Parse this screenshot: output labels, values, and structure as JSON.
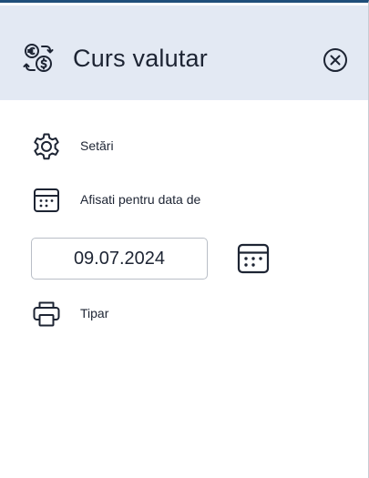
{
  "panel": {
    "title": "Curs valutar",
    "title_icon": "currency-exchange-icon",
    "close_icon": "close-circle-icon"
  },
  "menu": {
    "settings_label": "Setări",
    "settings_icon": "gear-icon",
    "show_for_date_label": "Afisati pentru data de",
    "show_for_date_icon": "calendar-icon",
    "date_value": "09.07.2024",
    "date_picker_icon": "calendar-icon",
    "print_label": "Tipar",
    "print_icon": "printer-icon"
  },
  "colors": {
    "header_bg": "#e3e9f3",
    "top_accent": "#1f4e79",
    "text": "#1d2433"
  }
}
